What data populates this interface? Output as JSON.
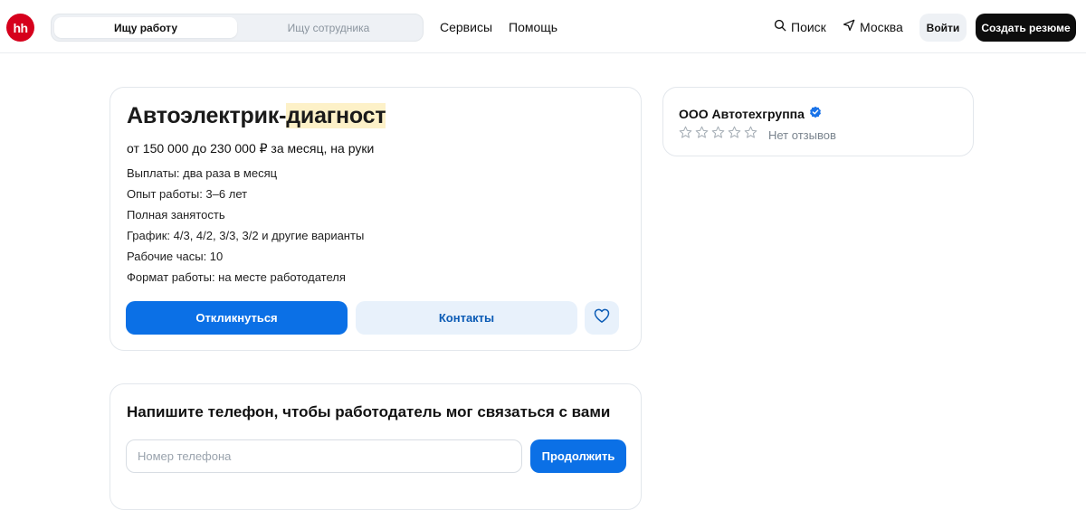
{
  "header": {
    "logo_text": "hh",
    "mode_tabs": [
      "Ищу работу",
      "Ищу сотрудника"
    ],
    "nav": {
      "services": "Сервисы",
      "help": "Помощь"
    },
    "search_label": "Поиск",
    "city": "Москва",
    "login_label": "Войти",
    "create_resume_label": "Создать резюме",
    "brand_color": "#d6001c"
  },
  "vacancy": {
    "title_part1": "Автоэлектрик-",
    "title_part2": "диагност",
    "salary": "от 150 000 до 230 000 ₽ за месяц, на руки",
    "details": [
      "Выплаты: два раза в месяц",
      "Опыт работы: 3–6 лет",
      "Полная занятость",
      "График: 4/3, 4/2, 3/3, 3/2 и другие варианты",
      "Рабочие часы: 10",
      "Формат работы: на месте работодателя"
    ],
    "respond_label": "Откликнуться",
    "contacts_label": "Контакты",
    "favorite_icon": "heart-icon",
    "accent_color": "#0b70e6"
  },
  "employer": {
    "name": "ООО Автотехгруппа",
    "verified_icon": "verified-badge-icon",
    "rating_stars": 0,
    "reviews_text": "Нет отзывов"
  },
  "phone_form": {
    "title": "Напишите телефон, чтобы работодатель мог связаться с вами",
    "placeholder": "Номер телефона",
    "value": "",
    "continue_label": "Продолжить"
  }
}
